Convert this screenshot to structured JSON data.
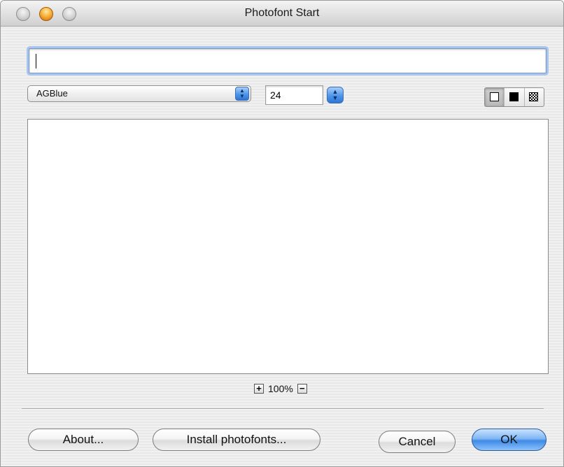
{
  "window": {
    "title": "Photofont Start"
  },
  "text_input": {
    "value": "",
    "placeholder": ""
  },
  "font_selector": {
    "selected": "AGBlue"
  },
  "size_selector": {
    "value": "24"
  },
  "background_options": {
    "selected": "white",
    "items": [
      "white",
      "black",
      "transparent"
    ]
  },
  "zoom": {
    "level": "100%",
    "plus_glyph": "+",
    "minus_glyph": "−"
  },
  "buttons": {
    "about": "About...",
    "install": "Install photofonts...",
    "cancel": "Cancel",
    "ok": "OK"
  },
  "colors": {
    "default_button": "#4c96ea",
    "minimize_light": "#f7b33a",
    "focus_ring": "#a9c5ec"
  },
  "icons": {
    "up_arrow": "▲",
    "down_arrow": "▼"
  }
}
